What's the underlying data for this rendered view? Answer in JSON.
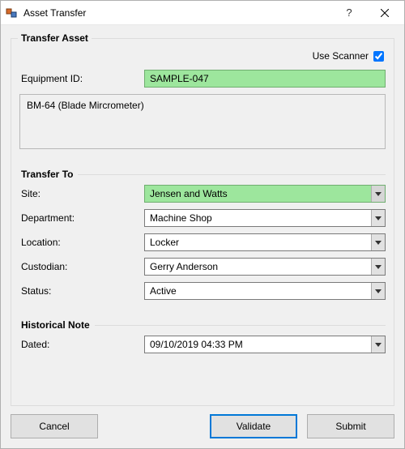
{
  "window": {
    "title": "Asset Transfer"
  },
  "group": {
    "title": "Transfer Asset",
    "scanner_label": "Use Scanner",
    "scanner_checked": true,
    "equipment_id_label": "Equipment ID:",
    "equipment_id_value": "SAMPLE-047",
    "description": "BM-64 (Blade Mircrometer)"
  },
  "transfer_to": {
    "title": "Transfer To",
    "site_label": "Site:",
    "site_value": "Jensen and Watts",
    "department_label": "Department:",
    "department_value": "Machine Shop",
    "location_label": "Location:",
    "location_value": "Locker",
    "custodian_label": "Custodian:",
    "custodian_value": "Gerry Anderson",
    "status_label": "Status:",
    "status_value": "Active"
  },
  "historical": {
    "title": "Historical Note",
    "dated_label": "Dated:",
    "dated_value": "09/10/2019 04:33 PM"
  },
  "buttons": {
    "cancel": "Cancel",
    "validate": "Validate",
    "submit": "Submit"
  }
}
